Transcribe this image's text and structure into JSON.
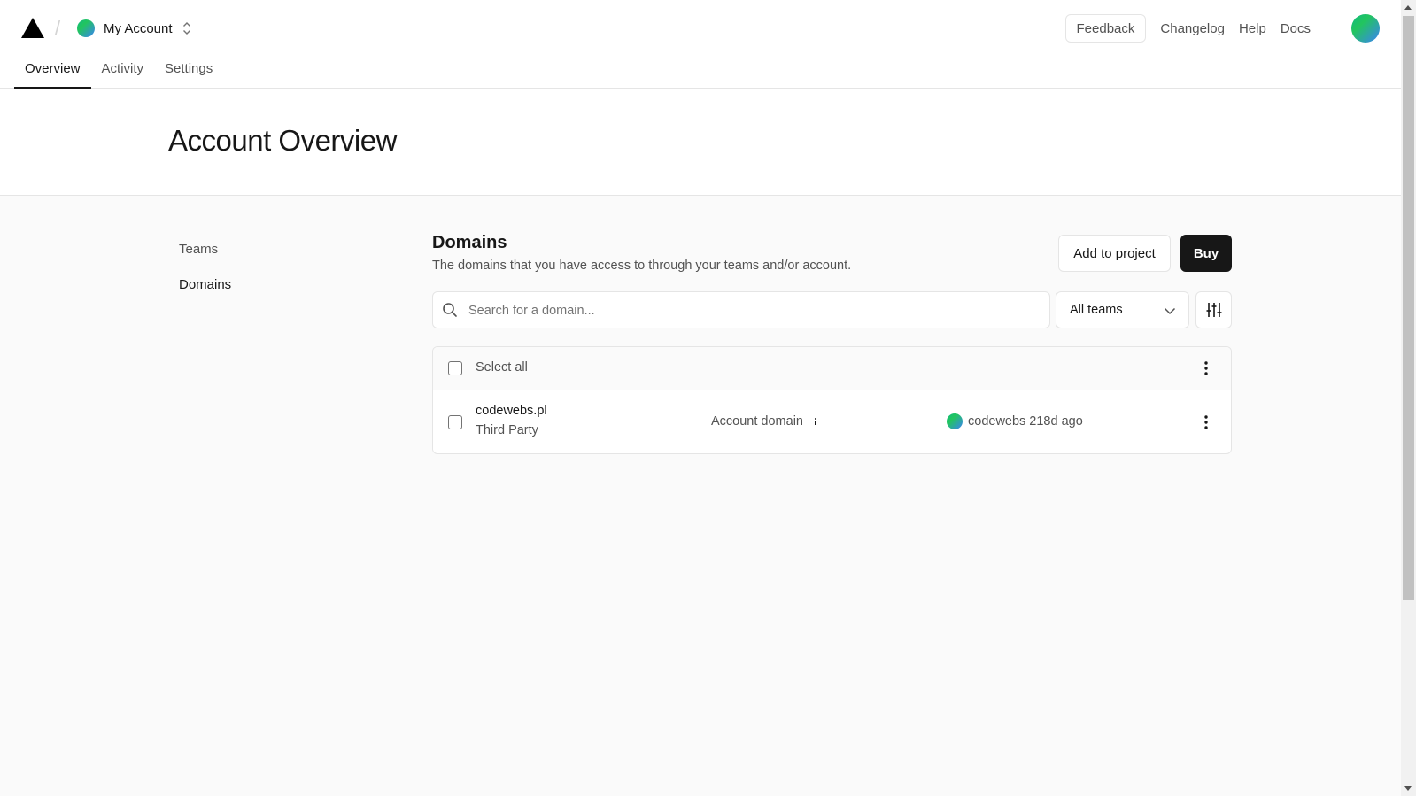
{
  "header": {
    "account_name": "My Account",
    "tabs": [
      {
        "label": "Overview",
        "active": true
      },
      {
        "label": "Activity",
        "active": false
      },
      {
        "label": "Settings",
        "active": false
      }
    ],
    "right_nav": {
      "feedback": "Feedback",
      "changelog": "Changelog",
      "help": "Help",
      "docs": "Docs"
    }
  },
  "page_title": "Account Overview",
  "sidebar": {
    "items": [
      {
        "label": "Teams",
        "active": false
      },
      {
        "label": "Domains",
        "active": true
      }
    ]
  },
  "domains": {
    "title": "Domains",
    "description": "The domains that you have access to through your teams and/or account.",
    "add_to_project_label": "Add to project",
    "buy_label": "Buy",
    "search_placeholder": "Search for a domain...",
    "team_filter_value": "All teams",
    "select_all_label": "Select all",
    "rows": [
      {
        "name": "codewebs.pl",
        "registrar": "Third Party",
        "scope": "Account domain",
        "owner": "codewebs",
        "age": "218d ago"
      }
    ]
  },
  "colors": {
    "primary": "#171717",
    "muted_text": "#525252",
    "border": "#e5e5e5",
    "background": "#fafafa",
    "avatar_gradient": [
      "#22c55e",
      "#3b82f6"
    ]
  },
  "icons": [
    "logo-triangle-icon",
    "chevron-up-down-icon",
    "search-icon",
    "chevron-down-icon",
    "sliders-icon",
    "kebab-menu-icon",
    "info-icon"
  ]
}
